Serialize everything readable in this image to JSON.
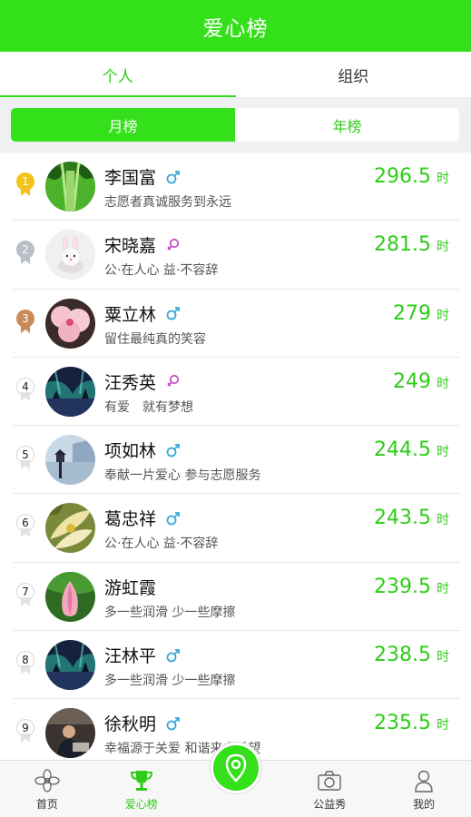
{
  "header": {
    "title": "爱心榜"
  },
  "tabs": [
    {
      "label": "个人",
      "active": true
    },
    {
      "label": "组织",
      "active": false
    }
  ],
  "segment": [
    {
      "label": "月榜",
      "active": true
    },
    {
      "label": "年榜",
      "active": false
    }
  ],
  "hours_unit": "时",
  "colors": {
    "accent": "#34e01a",
    "accent_text": "#2ecc18",
    "male": "#3aa8d8",
    "female": "#c94fc1",
    "gold": "#f2c31b",
    "silver": "#b9bfc6",
    "bronze": "#c98a58"
  },
  "list": [
    {
      "rank": "1",
      "name": "李国富",
      "gender": "male",
      "motto": "志愿者真诚服务到永远",
      "hours": "296.5"
    },
    {
      "rank": "2",
      "name": "宋晓嘉",
      "gender": "female",
      "motto": "公·在人心 益·不容辞",
      "hours": "281.5"
    },
    {
      "rank": "3",
      "name": "粟立林",
      "gender": "male",
      "motto": "留住最纯真的笑容",
      "hours": "279"
    },
    {
      "rank": "4",
      "name": "汪秀英",
      "gender": "female",
      "motto": "有爱　就有梦想",
      "hours": "249"
    },
    {
      "rank": "5",
      "name": "项如林",
      "gender": "male",
      "motto": "奉献一片爱心 参与志愿服务",
      "hours": "244.5"
    },
    {
      "rank": "6",
      "name": "葛忠祥",
      "gender": "male",
      "motto": "公·在人心 益·不容辞",
      "hours": "243.5"
    },
    {
      "rank": "7",
      "name": "游虹霞",
      "gender": "",
      "motto": "多一些润滑 少一些摩擦",
      "hours": "239.5"
    },
    {
      "rank": "8",
      "name": "汪林平",
      "gender": "male",
      "motto": "多一些润滑 少一些摩擦",
      "hours": "238.5"
    },
    {
      "rank": "9",
      "name": "徐秋明",
      "gender": "male",
      "motto": "幸福源于关爱 和谐来自希望",
      "hours": "235.5"
    }
  ],
  "tabbar": [
    {
      "label": "首页",
      "icon": "home-flower-icon",
      "active": false
    },
    {
      "label": "爱心榜",
      "icon": "trophy-icon",
      "active": true
    },
    {
      "label": "",
      "icon": "location-pin-icon",
      "active": false
    },
    {
      "label": "公益秀",
      "icon": "camera-icon",
      "active": false
    },
    {
      "label": "我的",
      "icon": "user-icon",
      "active": false
    }
  ]
}
